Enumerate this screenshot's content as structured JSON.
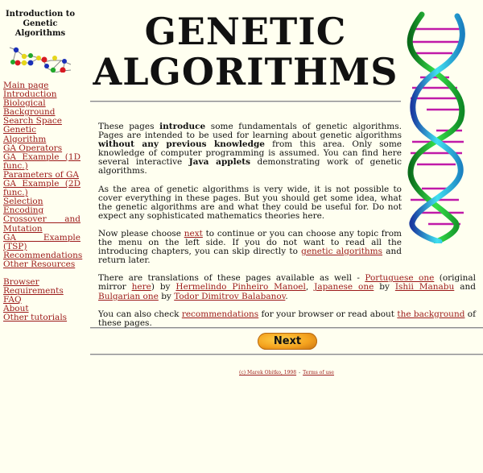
{
  "sidebar": {
    "logo_title": "Introduction to Genetic Algorithms",
    "menu": [
      {
        "label": "Main page"
      },
      {
        "label": "Introduction"
      },
      {
        "label": "Biological Background"
      },
      {
        "label": "Search Space"
      },
      {
        "label": "Genetic Algorithm"
      },
      {
        "label": "GA Operators"
      },
      {
        "label": "GA Example (1D func.)"
      },
      {
        "label": "Parameters of GA"
      },
      {
        "label": "GA Example (2D func.)"
      },
      {
        "label": "Selection"
      },
      {
        "label": "Encoding"
      },
      {
        "label": "Crossover and Mutation"
      },
      {
        "label": "GA Example (TSP)"
      },
      {
        "label": "Recommendations"
      },
      {
        "label": "Other Resources"
      }
    ],
    "menu2": [
      {
        "label": "Browser Requirements"
      },
      {
        "label": "FAQ"
      },
      {
        "label": "About"
      },
      {
        "label": "Other tutorials"
      }
    ]
  },
  "header": {
    "title_line1": "GENETIC",
    "title_line2": "ALGORITHMS"
  },
  "content": {
    "p1": {
      "t1": "These pages ",
      "b1": "introduce",
      "t2": " some fundamentals of genetic algorithms. Pages are intended to be used for learning about genetic algorithms ",
      "b2": "without any previous knowledge",
      "t3": " from this area. Only some knowledge of computer programming is assumed. You can find here several interactive ",
      "b3": "Java applets",
      "t4": " demonstrating work of genetic algorithms."
    },
    "p2": "As the area of genetic algorithms is very wide, it is not possible to cover everything in these pages. But you should get some idea, what the genetic algorithms are and what they could be useful for. Do not expect any sophisticated mathematics theories here.",
    "p3": {
      "t1": "Now please choose ",
      "link1": "next",
      "t2": " to continue or you can choose any topic from the menu on the left side. If you do not want to read all the introducing chapters, you can skip directly to ",
      "link2": "genetic algorithms",
      "t3": " and return later."
    },
    "p4": {
      "t1": "There are translations of these pages available as well - ",
      "link1": "Portuguese one",
      "t2": " (original mirror ",
      "link2": "here",
      "t3": ") by ",
      "link3": "Hermelindo Pinheiro Manoel",
      "t4": ", ",
      "link4": "Japanese one",
      "t5": " by ",
      "link5": "Ishii Manabu",
      "t6": " and ",
      "link6": "Bulgarian one",
      "t7": " by ",
      "link7": "Todor Dimitrov Balabanov",
      "t8": "."
    },
    "p5": {
      "t1": "You can also check ",
      "link1": "recommendations",
      "t2": " for your browser or read about ",
      "link2": "the background",
      "t3": " of these pages."
    }
  },
  "nav": {
    "next_label": "Next"
  },
  "footer": {
    "copyright": "(c) Marek Obitko, 1998",
    "separator": "-",
    "terms": "Terms of use"
  },
  "colors": {
    "background": "#fffff0",
    "link": "#9c1a1a"
  }
}
